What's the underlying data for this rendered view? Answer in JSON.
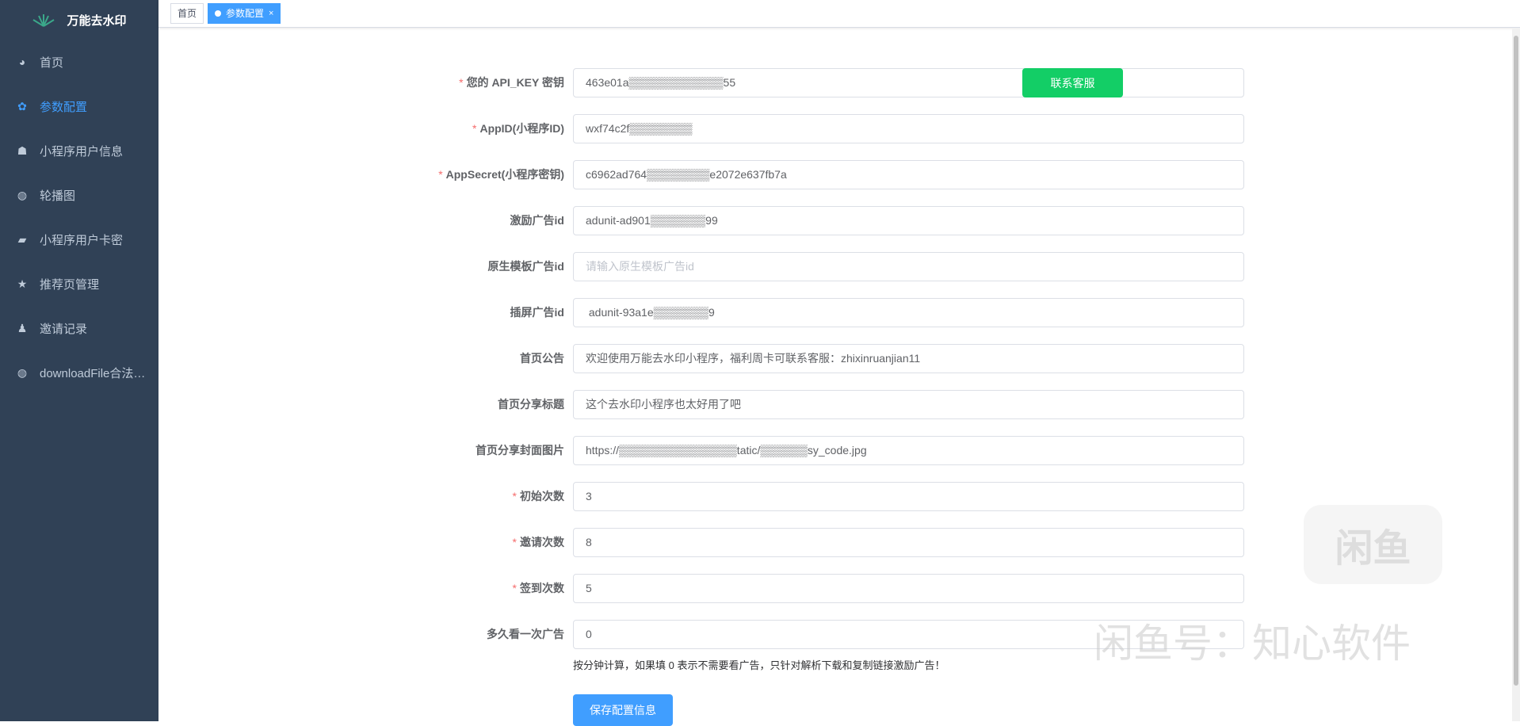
{
  "app": {
    "title": "万能去水印"
  },
  "sidebar": {
    "items": [
      {
        "label": "首页",
        "icon": "dashboard-icon",
        "glyph": "◕"
      },
      {
        "label": "参数配置",
        "icon": "gear-icon",
        "glyph": "✿"
      },
      {
        "label": "小程序用户信息",
        "icon": "user-group-icon",
        "glyph": "☗"
      },
      {
        "label": "轮播图",
        "icon": "globe-icon",
        "glyph": "◍"
      },
      {
        "label": "小程序用户卡密",
        "icon": "lock-icon",
        "glyph": "▰"
      },
      {
        "label": "推荐页管理",
        "icon": "star-icon",
        "glyph": "★"
      },
      {
        "label": "邀请记录",
        "icon": "user-icon",
        "glyph": "♟"
      },
      {
        "label": "downloadFile合法域名",
        "icon": "globe-icon",
        "glyph": "◍"
      }
    ]
  },
  "tabs": [
    {
      "label": "首页"
    },
    {
      "label": "参数配置",
      "close": "×"
    }
  ],
  "form": {
    "fields": [
      {
        "label": "您的 API_KEY 密钥",
        "required": true,
        "value": "463e01a▒▒▒▒▒▒▒▒▒▒▒▒55",
        "placeholder": ""
      },
      {
        "label": "AppID(小程序ID)",
        "required": true,
        "value": "wxf74c2f▒▒▒▒▒▒▒▒",
        "placeholder": ""
      },
      {
        "label": "AppSecret(小程序密钥)",
        "required": true,
        "value": "c6962ad764▒▒▒▒▒▒▒▒e2072e637fb7a",
        "placeholder": ""
      },
      {
        "label": "激励广告id",
        "required": false,
        "value": "adunit-ad901▒▒▒▒▒▒▒99",
        "placeholder": ""
      },
      {
        "label": "原生模板广告id",
        "required": false,
        "value": "",
        "placeholder": "请输入原生模板广告id"
      },
      {
        "label": "插屏广告id",
        "required": false,
        "value": " adunit-93a1e▒▒▒▒▒▒▒9",
        "placeholder": ""
      },
      {
        "label": "首页公告",
        "required": false,
        "value": "欢迎使用万能去水印小程序，福利周卡可联系客服：zhixinruanjian11",
        "placeholder": ""
      },
      {
        "label": "首页分享标题",
        "required": false,
        "value": "这个去水印小程序也太好用了吧",
        "placeholder": ""
      },
      {
        "label": "首页分享封面图片",
        "required": false,
        "value": "https://▒▒▒▒▒▒▒▒▒▒▒▒▒▒▒tatic/▒▒▒▒▒▒sy_code.jpg",
        "placeholder": ""
      },
      {
        "label": "初始次数",
        "required": true,
        "value": "3",
        "placeholder": ""
      },
      {
        "label": "邀请次数",
        "required": true,
        "value": "8",
        "placeholder": ""
      },
      {
        "label": "签到次数",
        "required": true,
        "value": "5",
        "placeholder": ""
      },
      {
        "label": "多久看一次广告",
        "required": false,
        "value": "0",
        "placeholder": ""
      }
    ],
    "hint": "按分钟计算，如果填 0 表示不需要看广告，只针对解析下载和复制链接激励广告！",
    "contact_button": "联系客服",
    "save_button": "保存配置信息",
    "required_mark": "*"
  },
  "colors": {
    "sidebar": "#304156",
    "primary": "#409eff",
    "success": "#13ce66"
  },
  "watermark": {
    "logo": "闲鱼",
    "text": "闲鱼号：知心软件"
  }
}
